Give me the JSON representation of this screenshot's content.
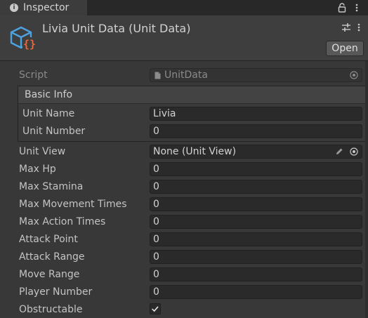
{
  "tab": {
    "label": "Inspector",
    "icon": "info-icon"
  },
  "header": {
    "title": "Livia Unit Data (Unit Data)",
    "open_label": "Open",
    "asset_icon": "scriptable-object-icon"
  },
  "script_field": {
    "label": "Script",
    "value": "UnitData"
  },
  "basic_info": {
    "title": "Basic Info",
    "unit_name": {
      "label": "Unit Name",
      "value": "Livia"
    },
    "unit_number": {
      "label": "Unit Number",
      "value": "0"
    }
  },
  "unit_view": {
    "label": "Unit View",
    "value": "None (Unit View)"
  },
  "fields": [
    {
      "label": "Max Hp",
      "value": "0"
    },
    {
      "label": "Max Stamina",
      "value": "0"
    },
    {
      "label": "Max Movement Times",
      "value": "0"
    },
    {
      "label": "Max Action Times",
      "value": "0"
    },
    {
      "label": "Attack Point",
      "value": "0"
    },
    {
      "label": "Attack Range",
      "value": "0"
    },
    {
      "label": "Move Range",
      "value": "0"
    },
    {
      "label": "Player Number",
      "value": "0"
    }
  ],
  "obstructable": {
    "label": "Obstructable",
    "checked": true
  },
  "colors": {
    "background": "#383838",
    "field": "#2a2a2a",
    "icon_blue": "#4da3e0",
    "icon_orange": "#e8683a"
  }
}
